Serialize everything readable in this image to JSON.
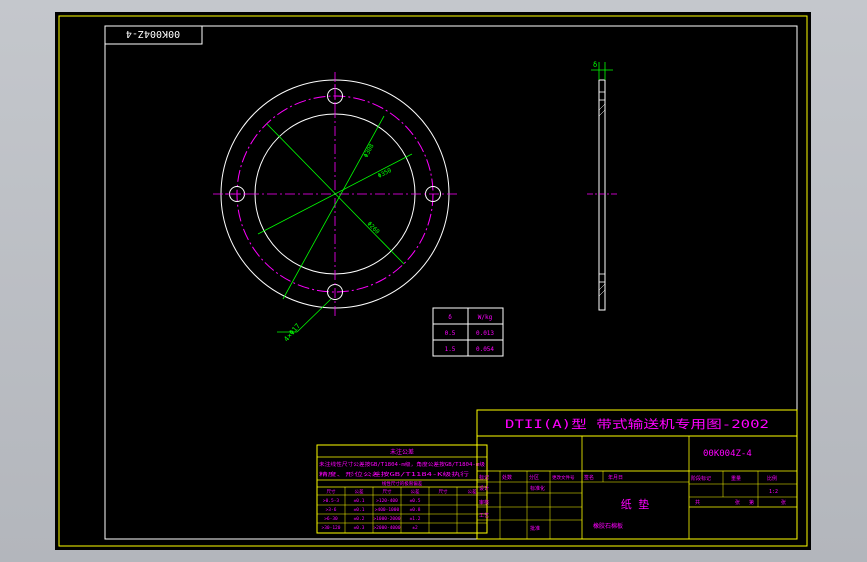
{
  "colors": {
    "background": "#000000",
    "frame": "#ffffff",
    "title_block": "#ffff00",
    "dimension": "#00ff00",
    "text": "#ff00ff",
    "bolt_circle": "#ff00ff"
  },
  "drawing": {
    "corner_code": "00K004Z-4",
    "dim_labels": {
      "bolt_circle": "Φ308",
      "outer_diameter": "Φ350",
      "inner_diameter": "Φ260",
      "holes": "4×Φ17"
    },
    "weight_table": {
      "headers": [
        "δ",
        "W/kg"
      ],
      "rows": [
        [
          "0.5",
          "0.013"
        ],
        [
          "1.5",
          "0.054"
        ]
      ]
    },
    "side_view_dim": "δ"
  },
  "title_block": {
    "title": "DTII(A)型 带式输送机专用图-2002",
    "drawing_number": "00K004Z-4",
    "part_name": "纸 垫",
    "material": "橡胶石棉板",
    "row_labels": [
      "标记",
      "处数",
      "分区",
      "更改文件号",
      "签名",
      "年月日"
    ],
    "left_labels": [
      "设计",
      "审核",
      "工艺"
    ],
    "mid_labels": [
      "标准化",
      "批准"
    ],
    "right_labels": [
      "阶段标记",
      "重量",
      "比例"
    ],
    "scale": "1:2",
    "sheet_labels": [
      "共",
      "张",
      "第",
      "张"
    ]
  },
  "tolerance_table": {
    "title": "未注公差",
    "notes": [
      "未注线性尺寸公差按GB/T1804-m级，角度公差按GB/T1804-m级",
      "精度、形位公差按GB/T1184-K级执行"
    ],
    "subtitle": "线性尺寸的极限偏差",
    "headers": [
      "尺寸",
      "公差",
      "尺寸",
      "公差",
      "尺寸",
      "公差"
    ],
    "rows": [
      [
        ">0.5-3",
        "±0.1",
        ">120-400",
        "±0.5",
        "",
        ""
      ],
      [
        ">3-6",
        "±0.1",
        ">400-1000",
        "±0.8",
        "",
        ""
      ],
      [
        ">6-30",
        "±0.2",
        ">1000-2000",
        "±1.2",
        "",
        ""
      ],
      [
        ">30-120",
        "±0.3",
        ">2000-4000",
        "±2",
        "",
        ""
      ]
    ]
  }
}
